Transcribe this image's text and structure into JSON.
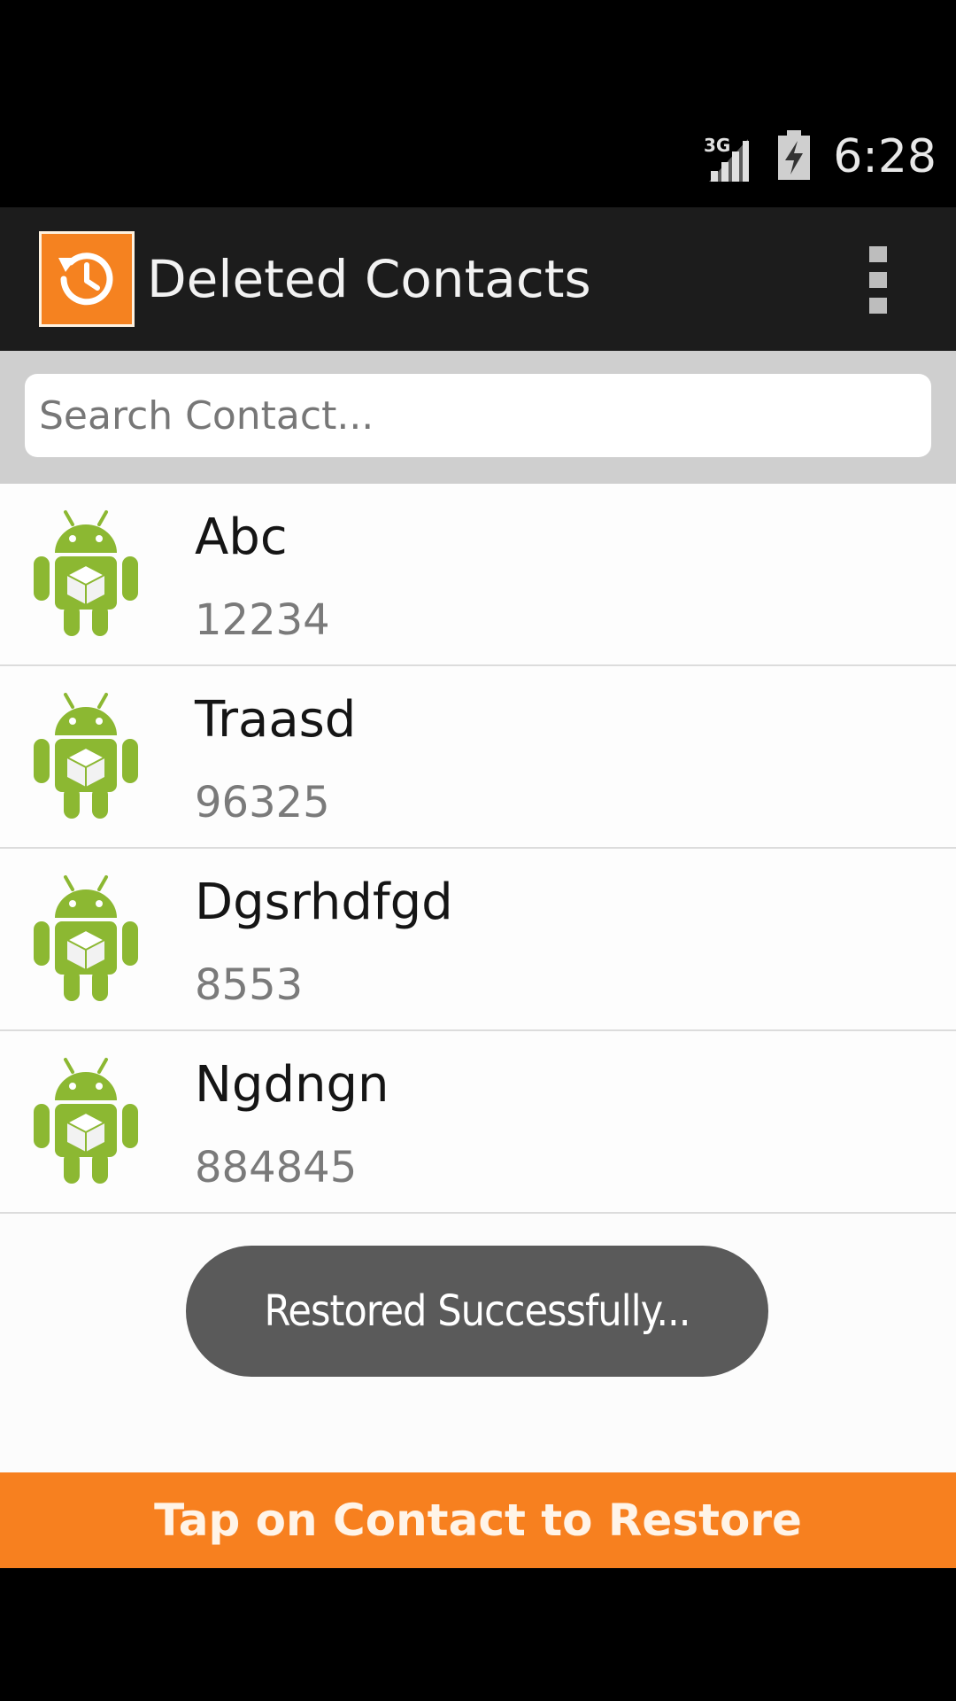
{
  "status_bar": {
    "network_label": "3G",
    "time": "6:28"
  },
  "action_bar": {
    "title": "Deleted Contacts",
    "logo_icon": "restore-clock-icon",
    "menu_icon": "overflow-menu-icon"
  },
  "search": {
    "placeholder": "Search Contact..."
  },
  "contacts": [
    {
      "name": "Abc",
      "number": "12234"
    },
    {
      "name": "Traasd",
      "number": "96325"
    },
    {
      "name": "Dgsrhdfgd",
      "number": "8553"
    },
    {
      "name": "Ngdngn",
      "number": "884845"
    }
  ],
  "toast": {
    "message": "Restored Successfully..."
  },
  "footer": {
    "hint": "Tap on Contact to Restore"
  },
  "colors": {
    "accent": "#f7801f",
    "android_green": "#8cb832",
    "toast_bg": "#5a5a5a"
  }
}
